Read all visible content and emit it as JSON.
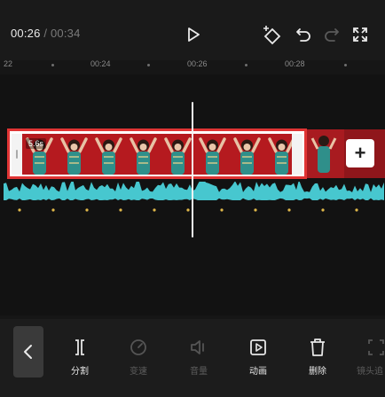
{
  "header": {
    "current_time": "00:26",
    "separator": " / ",
    "total_time": "00:34"
  },
  "ruler": {
    "labels": [
      "22",
      "00:24",
      "00:26",
      "00:28"
    ]
  },
  "track": {
    "clip_duration": "5.6s"
  },
  "toolbar": {
    "tools": [
      {
        "label": "分割",
        "enabled": true,
        "icon": "split-icon"
      },
      {
        "label": "变速",
        "enabled": false,
        "icon": "speed-icon"
      },
      {
        "label": "音量",
        "enabled": false,
        "icon": "volume-icon"
      },
      {
        "label": "动画",
        "enabled": true,
        "icon": "animation-icon"
      },
      {
        "label": "删除",
        "enabled": true,
        "icon": "delete-icon"
      },
      {
        "label": "镜头追",
        "enabled": false,
        "icon": "camera-track-icon"
      }
    ]
  },
  "colors": {
    "clip_frame_border": "#e03434",
    "audio_wave": "#47c7cf",
    "playhead": "#f4f4f4"
  }
}
